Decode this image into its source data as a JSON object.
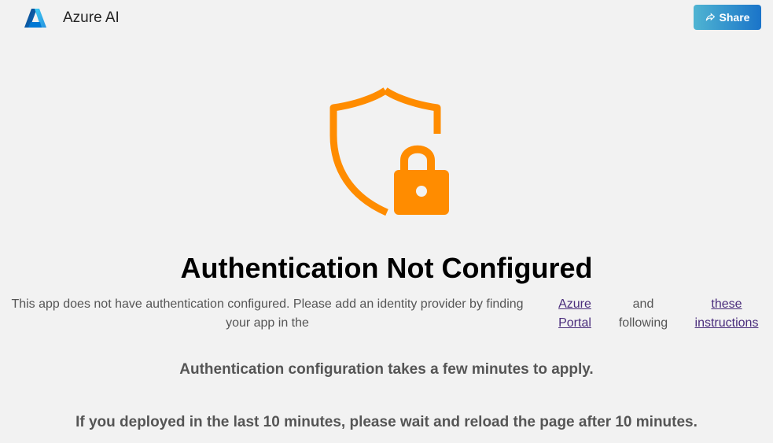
{
  "header": {
    "title": "Azure AI",
    "share_label": "Share"
  },
  "main": {
    "headline": "Authentication Not Configured",
    "message_text": "This app does not have authentication configured. Please add an identity provider by finding your app in the",
    "link_portal": "Azure Portal",
    "message_connector": "and following",
    "link_instructions": "these instructions",
    "note_1": "Authentication configuration takes a few minutes to apply.",
    "note_2": "If you deployed in the last 10 minutes, please wait and reload the page after 10 minutes."
  },
  "colors": {
    "shield": "#ff8c00",
    "share_gradient_start": "#4fb4d2",
    "share_gradient_end": "#1a74c9",
    "link": "#4a2d7c"
  },
  "icons": {
    "logo": "azure-logo",
    "share": "share-icon",
    "shield": "shield-lock-icon"
  }
}
